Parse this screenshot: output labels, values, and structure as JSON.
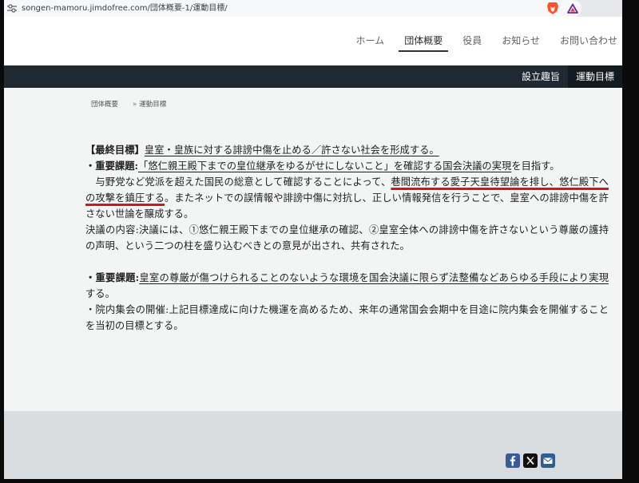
{
  "browser": {
    "url": "songen-mamoru.jimdofree.com/団体概要-1/運動目標/",
    "icons": [
      "site-info-icon",
      "brave-shields-icon",
      "brave-rewards-icon"
    ]
  },
  "header": {
    "nav": [
      {
        "label": "ホーム",
        "active": false
      },
      {
        "label": "団体概要",
        "active": true
      },
      {
        "label": "役員",
        "active": false
      },
      {
        "label": "お知らせ",
        "active": false
      },
      {
        "label": "お問い合わせ",
        "active": false
      }
    ]
  },
  "subnav": {
    "items": [
      {
        "label": "設立趣旨",
        "active": false
      },
      {
        "label": "運動目標",
        "active": true
      }
    ]
  },
  "breadcrumb": {
    "parent": "団体概要",
    "separator": "»",
    "current": "運動目標"
  },
  "article": {
    "final_goal": {
      "label": "【最終目標】",
      "text": "皇室・皇族に対する誹謗中傷を止める／許さない社会を形成する。"
    },
    "issue_1": {
      "label": "・重要課題:",
      "underlined": "「悠仁親王殿下までの皇位継承をゆるがせにしないこと」を確認する国会決議の実現",
      "rest": "を目指す。"
    },
    "issue_1_detail": {
      "before": "　与野党など党派を超えた国民の総意として確認することによって、",
      "highlighted": "巷間流布する愛子天皇待望論を排し、悠仁殿下への攻撃を鎮圧する",
      "after": "。またネットでの誤情報や誹謗中傷に対抗し、正しい情報発信を行うことで、皇室への誹謗中傷を許さない世論を醸成する。"
    },
    "resolution": "決議の内容:決議には、①悠仁親王殿下までの皇位継承の確認、②皇室全体への誹謗中傷を許さないという尊厳の護持の声明、という二つの柱を盛り込むべきとの意見が出され、共有された。",
    "issue_2": {
      "label": "・重要課題:",
      "underlined": "皇室の尊厳が傷つけられることのないような環境を国会決議に限らず法整備などあらゆる手段により実現",
      "rest": "する。"
    },
    "assembly": "・院内集会の開催:上記目標達成に向けた機運を高めるため、来年の通常国会会期中を目途に院内集会を開催することを当初の目標とする。"
  },
  "footer": {
    "social": [
      {
        "icon": "facebook-icon"
      },
      {
        "icon": "x-icon"
      },
      {
        "icon": "mail-icon"
      }
    ]
  },
  "colors": {
    "subnav_bg": "#1f2a32",
    "subnav_active_bg": "#131b21",
    "content_bg": "#f3f5f5",
    "footer_bg": "#d9dcde",
    "annotation_red": "#d3151d",
    "facebook_blue": "#3b5b98",
    "mail_blue": "#2f5f8f",
    "x_black": "#111111"
  }
}
